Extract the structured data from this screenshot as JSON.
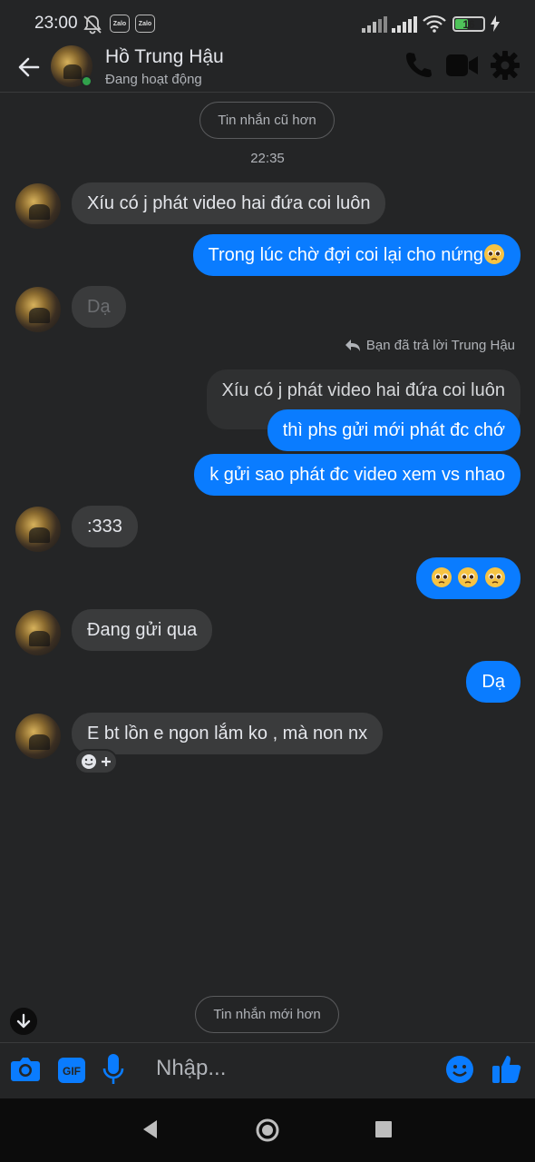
{
  "status_bar": {
    "time": "23:00",
    "zalo_1": "Zalo",
    "zalo_2": "Zalo",
    "battery": "16"
  },
  "header": {
    "contact_name": "Hồ Trung Hậu",
    "contact_status": "Đang hoạt động"
  },
  "older_messages_label": "Tin nhắn cũ hơn",
  "newer_messages_label": "Tin nhắn mới hơn",
  "timestamp": "22:35",
  "reply_label": "Bạn đã trả lời Trung Hậu",
  "messages": {
    "m1": "Xíu có j phát video hai đứa coi luôn",
    "m2": "Trong lúc chờ đợi coi lại cho nứng",
    "m3": "Dạ",
    "m4_quoted": "Xíu có j phát video hai đứa coi luôn",
    "m5": "thì phs gửi mới phát đc chớ",
    "m6": "k gửi sao phát đc video xem vs nhao",
    "m7": ":333",
    "m9": "Đang gửi qua",
    "m10": "Dạ",
    "m11": "E bt lồn e ngon lắm ko , mà non nx"
  },
  "composer": {
    "placeholder": "Nhập..."
  },
  "colors": {
    "background": "#242526",
    "incoming_bubble": "#3a3b3c",
    "outgoing_bubble": "#0a7cff",
    "accent": "#0a7cff",
    "online": "#31a24c"
  }
}
